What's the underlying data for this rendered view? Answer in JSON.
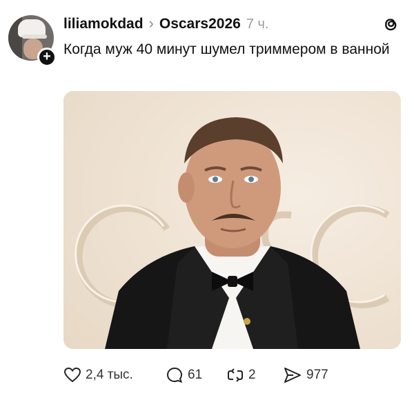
{
  "post": {
    "username": "liliamokdad",
    "topic": "Oscars2026",
    "time": "7 ч.",
    "text": "Когда муж 40 минут шумел триммером в ванной",
    "follow_icon": "plus-icon",
    "app_icon": "threads-logo"
  },
  "image": {
    "description_icon": "photo",
    "background_letters": "OSC"
  },
  "actions": {
    "likes": "2,4 тыс.",
    "comments": "61",
    "reposts": "2",
    "shares": "977"
  },
  "colors": {
    "accent": "#000000",
    "muted": "#9a9a9a",
    "photo_background": "#efe4d6",
    "suit": "#161616"
  }
}
